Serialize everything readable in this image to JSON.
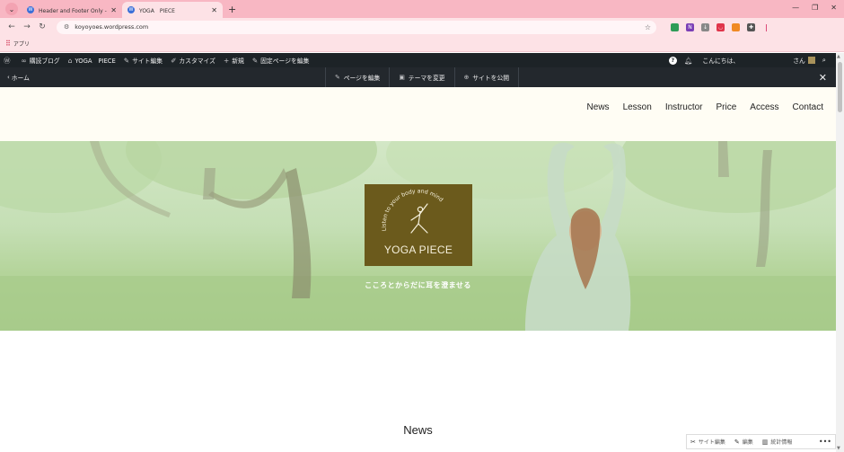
{
  "browser": {
    "tabs": [
      {
        "title": "Header and Footer Only - テンプ",
        "active": false
      },
      {
        "title": "YOGA　PIECE",
        "active": true
      }
    ],
    "url": "koyoyoes.wordpress.com",
    "bookmarks": [
      {
        "label": "アプリ"
      }
    ]
  },
  "adminbar": {
    "items": [
      {
        "label": "購読ブログ",
        "icon": "reader-icon"
      },
      {
        "label": "YOGA　PIECE",
        "icon": "home-icon"
      },
      {
        "label": "サイト編集",
        "icon": "brush-icon"
      },
      {
        "label": "カスタマイズ",
        "icon": "customize-icon"
      },
      {
        "label": "新規",
        "icon": "plus-icon"
      },
      {
        "label": "固定ページを編集",
        "icon": "edit-icon"
      }
    ],
    "greeting": "こんにちは、",
    "user_suffix": "さん"
  },
  "editbar": {
    "home_label": "ホーム",
    "edit_page": "ページを編集",
    "change_theme": "テーマを変更",
    "publish_site": "サイトを公開"
  },
  "site": {
    "nav": [
      "News",
      "Lesson",
      "Instructor",
      "Price",
      "Access",
      "Contact"
    ],
    "logo_arc_text": "Listen to your body and mind",
    "logo_title": "YOGA PIECE",
    "tagline": "こころとからだに耳を澄ませる",
    "section_heading": "News"
  },
  "float_bar": {
    "site_edit": "サイト編集",
    "edit": "編集",
    "stats": "統計情報"
  },
  "colors": {
    "tabstrip": "#f8b7c3",
    "chrome": "#fde2e6",
    "adminbar": "#1d2327",
    "header_bg": "#fffdf4",
    "logo_bg": "#6b5a1c"
  }
}
